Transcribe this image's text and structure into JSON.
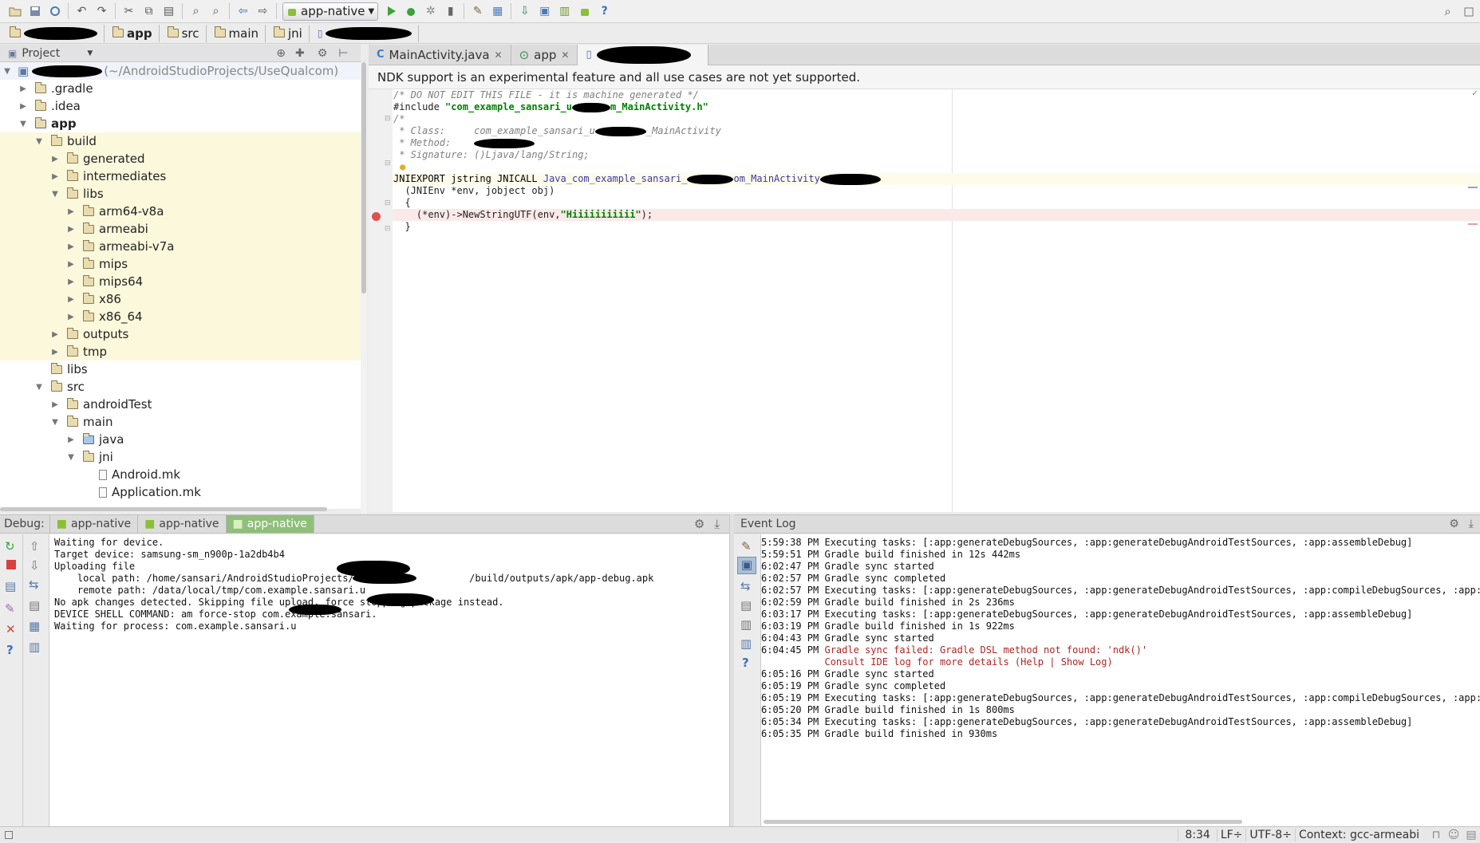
{
  "toolbar": {
    "run_config": "app-native",
    "icons": [
      "open-icon",
      "save-icon",
      "sync-icon",
      "undo-icon",
      "redo-icon",
      "cut-icon",
      "copy-icon",
      "paste-icon",
      "find-icon",
      "replace-icon",
      "back-icon",
      "forward-icon",
      "run-icon",
      "debug-icon",
      "attach-debugger-icon",
      "stop-icon",
      "project-structure-icon",
      "sdk-manager-icon",
      "avd-manager-icon",
      "android-device-monitor-icon",
      "android-icon",
      "help-icon"
    ]
  },
  "breadcrumb": [
    "app",
    "src",
    "main",
    "jni"
  ],
  "project_panel": {
    "title": "Project",
    "root_path": "(~/AndroidStudioProjects/UseQualcom)",
    "items": [
      {
        "label": ".gradle",
        "depth": 1,
        "expanded": false,
        "type": "folder",
        "bold": false,
        "highlight": false
      },
      {
        "label": ".idea",
        "depth": 1,
        "expanded": false,
        "type": "folder",
        "bold": false,
        "highlight": false
      },
      {
        "label": "app",
        "depth": 1,
        "expanded": true,
        "type": "module",
        "bold": true,
        "highlight": false
      },
      {
        "label": "build",
        "depth": 2,
        "expanded": true,
        "type": "folder",
        "bold": false,
        "highlight": true
      },
      {
        "label": "generated",
        "depth": 3,
        "expanded": false,
        "type": "folder",
        "bold": false,
        "highlight": true
      },
      {
        "label": "intermediates",
        "depth": 3,
        "expanded": false,
        "type": "folder",
        "bold": false,
        "highlight": true
      },
      {
        "label": "libs",
        "depth": 3,
        "expanded": true,
        "type": "folder",
        "bold": false,
        "highlight": true
      },
      {
        "label": "arm64-v8a",
        "depth": 4,
        "expanded": false,
        "type": "folder",
        "bold": false,
        "highlight": true
      },
      {
        "label": "armeabi",
        "depth": 4,
        "expanded": false,
        "type": "folder",
        "bold": false,
        "highlight": true
      },
      {
        "label": "armeabi-v7a",
        "depth": 4,
        "expanded": false,
        "type": "folder",
        "bold": false,
        "highlight": true
      },
      {
        "label": "mips",
        "depth": 4,
        "expanded": false,
        "type": "folder",
        "bold": false,
        "highlight": true
      },
      {
        "label": "mips64",
        "depth": 4,
        "expanded": false,
        "type": "folder",
        "bold": false,
        "highlight": true
      },
      {
        "label": "x86",
        "depth": 4,
        "expanded": false,
        "type": "folder",
        "bold": false,
        "highlight": true
      },
      {
        "label": "x86_64",
        "depth": 4,
        "expanded": false,
        "type": "folder",
        "bold": false,
        "highlight": true
      },
      {
        "label": "outputs",
        "depth": 3,
        "expanded": false,
        "type": "folder",
        "bold": false,
        "highlight": true
      },
      {
        "label": "tmp",
        "depth": 3,
        "expanded": false,
        "type": "folder",
        "bold": false,
        "highlight": true
      },
      {
        "label": "libs",
        "depth": 2,
        "expanded": null,
        "type": "folder",
        "bold": false,
        "highlight": false
      },
      {
        "label": "src",
        "depth": 2,
        "expanded": true,
        "type": "folder",
        "bold": false,
        "highlight": false
      },
      {
        "label": "androidTest",
        "depth": 3,
        "expanded": false,
        "type": "folder",
        "bold": false,
        "highlight": false
      },
      {
        "label": "main",
        "depth": 3,
        "expanded": true,
        "type": "folder",
        "bold": false,
        "highlight": false
      },
      {
        "label": "java",
        "depth": 4,
        "expanded": false,
        "type": "source-folder",
        "bold": false,
        "highlight": false
      },
      {
        "label": "jni",
        "depth": 4,
        "expanded": true,
        "type": "folder",
        "bold": false,
        "highlight": false
      },
      {
        "label": "Android.mk",
        "depth": 5,
        "expanded": null,
        "type": "file",
        "bold": false,
        "highlight": false
      },
      {
        "label": "Application.mk",
        "depth": 5,
        "expanded": null,
        "type": "file",
        "bold": false,
        "highlight": false
      }
    ]
  },
  "editor": {
    "tabs": [
      {
        "label": "MainActivity.java",
        "icon": "java-class-icon",
        "active": false
      },
      {
        "label": "app",
        "icon": "gradle-module-icon",
        "active": false
      },
      {
        "label": "",
        "icon": "c-file-icon",
        "active": true
      }
    ],
    "notice": "NDK support is an experimental feature and all use cases are not yet supported.",
    "code": {
      "l1": "/* DO NOT EDIT THIS FILE - it is machine generated */",
      "l2_pre": "#include ",
      "l2_str_a": "\"com_example_sansari_u",
      "l2_str_b": "m_MainActivity.h\"",
      "l3": "/*",
      "l4_a": " * Class:     com_example_sansari_u",
      "l4_b": "_MainActivity",
      "l5": " * Method:    ",
      "l6": " * Signature: ()Ljava/lang/String;",
      "l8_kw": "JNIEXPORT jstring JNICALL ",
      "l8_fn_a": "Java_com_example_sansari_",
      "l8_fn_b": "om_MainActivity",
      "l9": "  (JNIEnv *env, jobject obj)",
      "l10": "  {",
      "l11_a": "    (*env)->NewStringUTF(env,",
      "l11_str": "\"Hiiiiiiiiiii\"",
      "l11_b": ");",
      "l12": "  }"
    }
  },
  "debug": {
    "label": "Debug:",
    "tabs": [
      {
        "label": "app-native",
        "active": false
      },
      {
        "label": "app-native",
        "active": false
      },
      {
        "label": "app-native",
        "active": true
      }
    ],
    "log": [
      "Waiting for device.",
      "Target device: samsung-sm_n900p-1a2db4b4",
      "Uploading file",
      "    local path: /home/sansari/AndroidStudioProjects/                    /build/outputs/apk/app-debug.apk",
      "    remote path: /data/local/tmp/com.example.sansari.u",
      "No apk changes detected. Skipping file upload, force stopping package instead.",
      "DEVICE SHELL COMMAND: am force-stop com.example.sansari.",
      "Waiting for process: com.example.sansari.u"
    ],
    "side_icons_a": [
      "rerun-icon",
      "stop-icon",
      "view-breakpoints-icon",
      "mute-breakpoints-icon",
      "close-icon",
      "help-icon"
    ],
    "side_icons_b": [
      "up-icon",
      "down-icon",
      "wrap-icon",
      "scroll-to-end-icon",
      "print-icon",
      "clear-icon"
    ]
  },
  "event_log": {
    "title": "Event Log",
    "entries": [
      {
        "text": "5:59:38 PM Executing tasks: [:app:generateDebugSources, :app:generateDebugAndroidTestSources, :app:assembleDebug]",
        "error": false
      },
      {
        "text": "5:59:51 PM Gradle build finished in 12s 442ms",
        "error": false
      },
      {
        "text": "6:02:47 PM Gradle sync started",
        "error": false
      },
      {
        "text": "6:02:57 PM Gradle sync completed",
        "error": false
      },
      {
        "text": "6:02:57 PM Executing tasks: [:app:generateDebugSources, :app:generateDebugAndroidTestSources, :app:compileDebugSources, :app:c",
        "error": false
      },
      {
        "text": "6:02:59 PM Gradle build finished in 2s 236ms",
        "error": false
      },
      {
        "text": "6:03:17 PM Executing tasks: [:app:generateDebugSources, :app:generateDebugAndroidTestSources, :app:assembleDebug]",
        "error": false
      },
      {
        "text": "6:03:19 PM Gradle build finished in 1s 922ms",
        "error": false
      },
      {
        "text": "6:04:43 PM Gradle sync started",
        "error": false
      },
      {
        "text": "6:04:45 PM ",
        "error": false,
        "err_suffix": "Gradle sync failed: Gradle DSL method not found: 'ndk()'"
      },
      {
        "text": "           ",
        "error": false,
        "err_suffix": "Consult IDE log for more details (Help | Show Log)"
      },
      {
        "text": "6:05:16 PM Gradle sync started",
        "error": false
      },
      {
        "text": "6:05:19 PM Gradle sync completed",
        "error": false
      },
      {
        "text": "6:05:19 PM Executing tasks: [:app:generateDebugSources, :app:generateDebugAndroidTestSources, :app:compileDebugSources, :app:c",
        "error": false
      },
      {
        "text": "6:05:20 PM Gradle build finished in 1s 800ms",
        "error": false
      },
      {
        "text": "6:05:34 PM Executing tasks: [:app:generateDebugSources, :app:generateDebugAndroidTestSources, :app:assembleDebug]",
        "error": false
      },
      {
        "text": "6:05:35 PM Gradle build finished in 930ms",
        "error": false
      }
    ]
  },
  "status_bar": {
    "position": "8:34",
    "line_sep": "LF÷",
    "encoding": "UTF-8÷",
    "context": "Context: gcc-armeabi"
  },
  "colors": {
    "error_text": "#b02525",
    "highlight_row": "#fbf8dc",
    "active_debug_tab": "#8fbf7a",
    "breakpoint": "#e05050",
    "breakpoint_line": "#fbe9e9"
  }
}
